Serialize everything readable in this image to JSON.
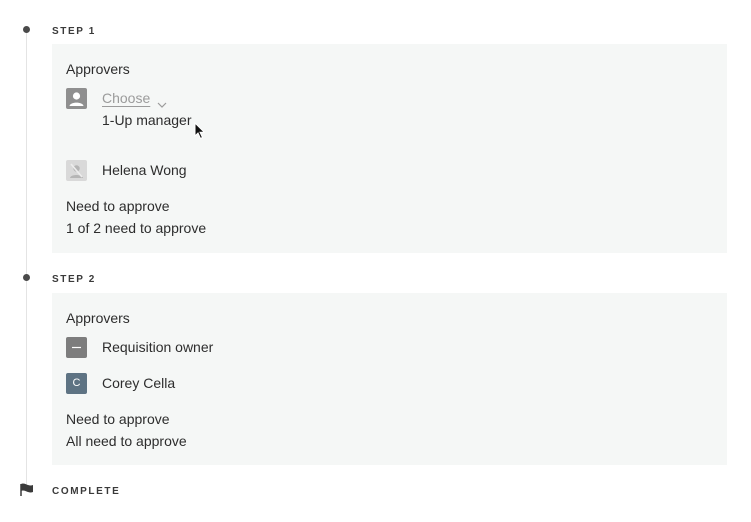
{
  "steps": [
    {
      "label": "STEP 1",
      "approvers_label": "Approvers",
      "choose_label": "Choose",
      "choose_subtitle": "1-Up manager",
      "person_name": "Helena Wong",
      "need_label": "Need to approve",
      "need_value": "1 of 2 need to approve"
    },
    {
      "label": "STEP 2",
      "approvers_label": "Approvers",
      "owner_label": "Requisition owner",
      "person_initial": "C",
      "person_name": "Corey Cella",
      "need_label": "Need to approve",
      "need_value": "All need to approve"
    }
  ],
  "complete_label": "COMPLETE",
  "colors": {
    "card_bg": "#f5f7f6",
    "avatar_blue": "#5e7383",
    "avatar_gray": "#9a9a9a"
  }
}
